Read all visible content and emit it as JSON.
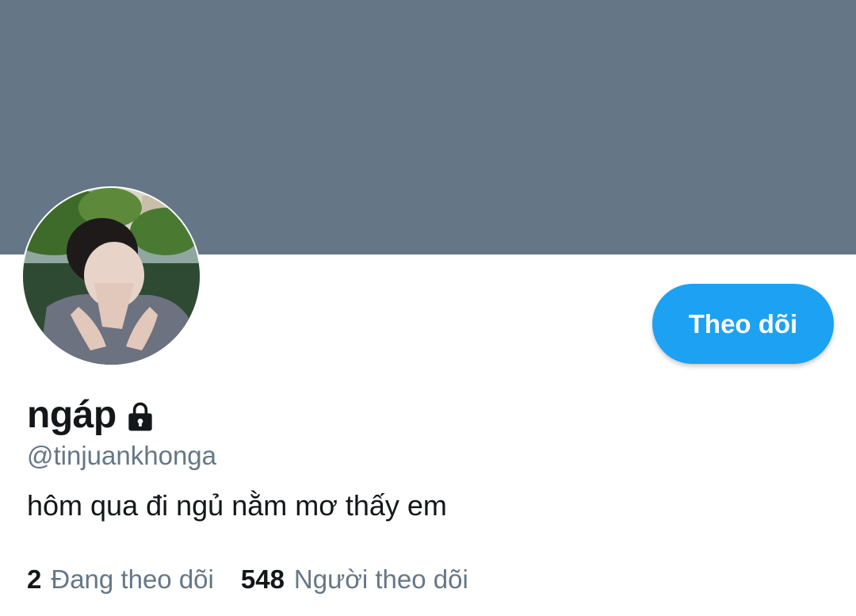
{
  "profile": {
    "display_name": "ngáp",
    "handle": "@tinjuankhonga",
    "bio": "hôm qua đi ngủ nằm mơ thấy em",
    "locked_icon": "lock-icon"
  },
  "actions": {
    "follow_label": "Theo dõi"
  },
  "stats": {
    "following_count": "2",
    "following_label": "Đang theo dõi",
    "followers_count": "548",
    "followers_label": "Người theo dõi"
  },
  "colors": {
    "banner": "#657786",
    "accent": "#1da1f2",
    "text_primary": "#14171a",
    "text_secondary": "#657786"
  }
}
